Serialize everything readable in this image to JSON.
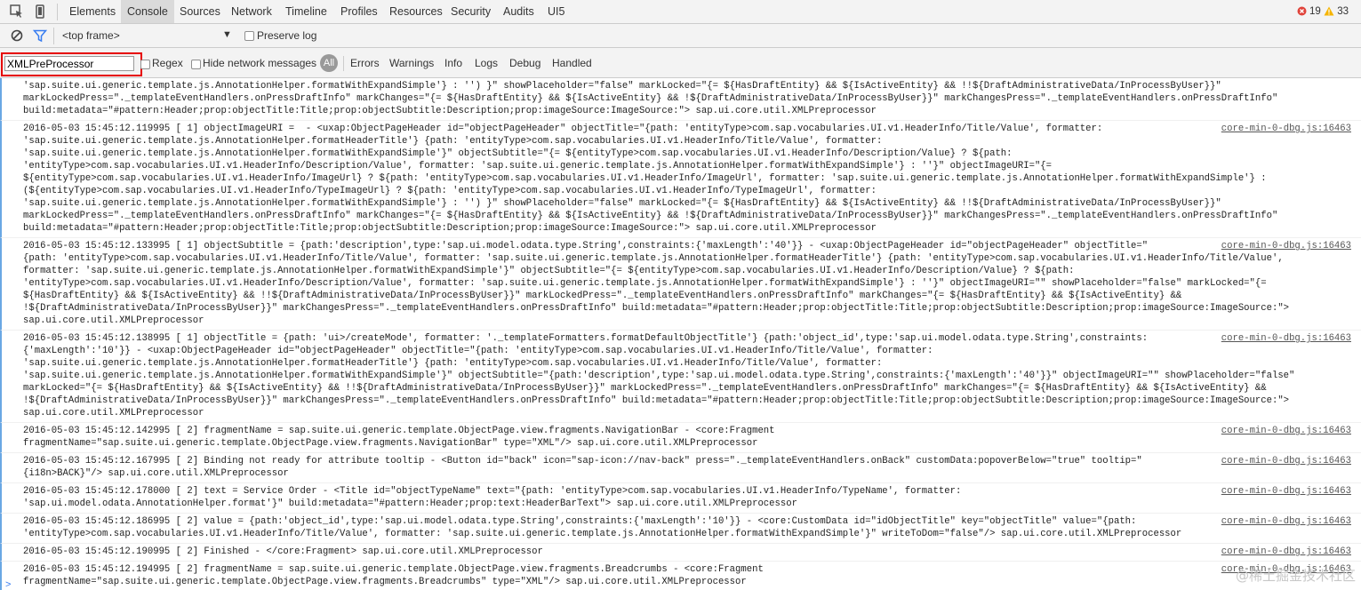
{
  "tabs": [
    {
      "label": "Elements",
      "active": false
    },
    {
      "label": "Console",
      "active": true
    },
    {
      "label": "Sources",
      "active": false
    },
    {
      "label": "Network",
      "active": false
    },
    {
      "label": "Timeline",
      "active": false
    },
    {
      "label": "Profiles",
      "active": false
    },
    {
      "label": "Resources",
      "active": false
    },
    {
      "label": "Security",
      "active": false
    },
    {
      "label": "Audits",
      "active": false
    },
    {
      "label": "UI5",
      "active": false
    }
  ],
  "status": {
    "errors": "19",
    "warnings": "33"
  },
  "toolbar": {
    "frame": "<top frame>",
    "preserve_log": "Preserve log"
  },
  "filter": {
    "value": "XMLPreProcessor",
    "regex": "Regex",
    "hide_network": "Hide network messages",
    "levels": [
      "All",
      "Errors",
      "Warnings",
      "Info",
      "Logs",
      "Debug",
      "Handled"
    ]
  },
  "log": [
    {
      "source": "",
      "lines": [
        "'sap.suite.ui.generic.template.js.AnnotationHelper.formatWithExpandSimple'} : '') }\" showPlaceholder=\"false\" markLocked=\"{= ${HasDraftEntity} && ${IsActiveEntity} && !!${DraftAdministrativeData/InProcessByUser}}\"",
        "markLockedPress=\"._templateEventHandlers.onPressDraftInfo\" markChanges=\"{= ${HasDraftEntity} && ${IsActiveEntity} && !${DraftAdministrativeData/InProcessByUser}}\" markChangesPress=\"._templateEventHandlers.onPressDraftInfo\"",
        "build:metadata=\"#pattern:Header;prop:objectTitle:Title;prop:objectSubtitle:Description;prop:imageSource:ImageSource:\"> sap.ui.core.util.XMLPreprocessor"
      ]
    },
    {
      "source": "core-min-0-dbg.js:16463",
      "lines": [
        "2016-05-03 15:45:12.119995 [ 1] objectImageURI =  - <uxap:ObjectPageHeader id=\"objectPageHeader\" objectTitle=\"{path: 'entityType>com.sap.vocabularies.UI.v1.HeaderInfo/Title/Value', formatter:",
        "'sap.suite.ui.generic.template.js.AnnotationHelper.formatHeaderTitle'} {path: 'entityType>com.sap.vocabularies.UI.v1.HeaderInfo/Title/Value', formatter:",
        "'sap.suite.ui.generic.template.js.AnnotationHelper.formatWithExpandSimple'}\" objectSubtitle=\"{= ${entityType>com.sap.vocabularies.UI.v1.HeaderInfo/Description/Value} ? ${path:",
        "'entityType>com.sap.vocabularies.UI.v1.HeaderInfo/Description/Value', formatter: 'sap.suite.ui.generic.template.js.AnnotationHelper.formatWithExpandSimple'} : ''}\" objectImageURI=\"{=",
        "${entityType>com.sap.vocabularies.UI.v1.HeaderInfo/ImageUrl} ? ${path: 'entityType>com.sap.vocabularies.UI.v1.HeaderInfo/ImageUrl', formatter: 'sap.suite.ui.generic.template.js.AnnotationHelper.formatWithExpandSimple'} :",
        "(${entityType>com.sap.vocabularies.UI.v1.HeaderInfo/TypeImageUrl} ? ${path: 'entityType>com.sap.vocabularies.UI.v1.HeaderInfo/TypeImageUrl', formatter:",
        "'sap.suite.ui.generic.template.js.AnnotationHelper.formatWithExpandSimple'} : '') }\" showPlaceholder=\"false\" markLocked=\"{= ${HasDraftEntity} && ${IsActiveEntity} && !!${DraftAdministrativeData/InProcessByUser}}\"",
        "markLockedPress=\"._templateEventHandlers.onPressDraftInfo\" markChanges=\"{= ${HasDraftEntity} && ${IsActiveEntity} && !${DraftAdministrativeData/InProcessByUser}}\" markChangesPress=\"._templateEventHandlers.onPressDraftInfo\"",
        "build:metadata=\"#pattern:Header;prop:objectTitle:Title;prop:objectSubtitle:Description;prop:imageSource:ImageSource:\"> sap.ui.core.util.XMLPreprocessor"
      ]
    },
    {
      "source": "core-min-0-dbg.js:16463",
      "lines": [
        "2016-05-03 15:45:12.133995 [ 1] objectSubtitle = {path:'description',type:'sap.ui.model.odata.type.String',constraints:{'maxLength':'40'}} - <uxap:ObjectPageHeader id=\"objectPageHeader\" objectTitle=\"",
        "{path: 'entityType>com.sap.vocabularies.UI.v1.HeaderInfo/Title/Value', formatter: 'sap.suite.ui.generic.template.js.AnnotationHelper.formatHeaderTitle'} {path: 'entityType>com.sap.vocabularies.UI.v1.HeaderInfo/Title/Value',",
        "formatter: 'sap.suite.ui.generic.template.js.AnnotationHelper.formatWithExpandSimple'}\" objectSubtitle=\"{= ${entityType>com.sap.vocabularies.UI.v1.HeaderInfo/Description/Value} ? ${path:",
        "'entityType>com.sap.vocabularies.UI.v1.HeaderInfo/Description/Value', formatter: 'sap.suite.ui.generic.template.js.AnnotationHelper.formatWithExpandSimple'} : ''}\" objectImageURI=\"\" showPlaceholder=\"false\" markLocked=\"{=",
        "${HasDraftEntity} && ${IsActiveEntity} && !!${DraftAdministrativeData/InProcessByUser}}\" markLockedPress=\"._templateEventHandlers.onPressDraftInfo\" markChanges=\"{= ${HasDraftEntity} && ${IsActiveEntity} &&",
        "!${DraftAdministrativeData/InProcessByUser}}\" markChangesPress=\"._templateEventHandlers.onPressDraftInfo\" build:metadata=\"#pattern:Header;prop:objectTitle:Title;prop:objectSubtitle:Description;prop:imageSource:ImageSource:\">",
        "sap.ui.core.util.XMLPreprocessor"
      ]
    },
    {
      "source": "core-min-0-dbg.js:16463",
      "lines": [
        "2016-05-03 15:45:12.138995 [ 1] objectTitle = {path: 'ui>/createMode', formatter: '._templateFormatters.formatDefaultObjectTitle'} {path:'object_id',type:'sap.ui.model.odata.type.String',constraints:",
        "{'maxLength':'10'}} - <uxap:ObjectPageHeader id=\"objectPageHeader\" objectTitle=\"{path: 'entityType>com.sap.vocabularies.UI.v1.HeaderInfo/Title/Value', formatter:",
        "'sap.suite.ui.generic.template.js.AnnotationHelper.formatHeaderTitle'} {path: 'entityType>com.sap.vocabularies.UI.v1.HeaderInfo/Title/Value', formatter:",
        "'sap.suite.ui.generic.template.js.AnnotationHelper.formatWithExpandSimple'}\" objectSubtitle=\"{path:'description',type:'sap.ui.model.odata.type.String',constraints:{'maxLength':'40'}}\" objectImageURI=\"\" showPlaceholder=\"false\"",
        "markLocked=\"{= ${HasDraftEntity} && ${IsActiveEntity} && !!${DraftAdministrativeData/InProcessByUser}}\" markLockedPress=\"._templateEventHandlers.onPressDraftInfo\" markChanges=\"{= ${HasDraftEntity} && ${IsActiveEntity} &&",
        "!${DraftAdministrativeData/InProcessByUser}}\" markChangesPress=\"._templateEventHandlers.onPressDraftInfo\" build:metadata=\"#pattern:Header;prop:objectTitle:Title;prop:objectSubtitle:Description;prop:imageSource:ImageSource:\">",
        "sap.ui.core.util.XMLPreprocessor"
      ]
    },
    {
      "source": "core-min-0-dbg.js:16463",
      "lines": [
        "2016-05-03 15:45:12.142995 [ 2] fragmentName = sap.suite.ui.generic.template.ObjectPage.view.fragments.NavigationBar - <core:Fragment",
        "fragmentName=\"sap.suite.ui.generic.template.ObjectPage.view.fragments.NavigationBar\" type=\"XML\"/> sap.ui.core.util.XMLPreprocessor"
      ]
    },
    {
      "source": "core-min-0-dbg.js:16463",
      "lines": [
        "2016-05-03 15:45:12.167995 [ 2] Binding not ready for attribute tooltip - <Button id=\"back\" icon=\"sap-icon://nav-back\" press=\"._templateEventHandlers.onBack\" customData:popoverBelow=\"true\" tooltip=\"",
        "{i18n>BACK}\"/> sap.ui.core.util.XMLPreprocessor"
      ]
    },
    {
      "source": "core-min-0-dbg.js:16463",
      "lines": [
        "2016-05-03 15:45:12.178000 [ 2] text = Service Order - <Title id=\"objectTypeName\" text=\"{path: 'entityType>com.sap.vocabularies.UI.v1.HeaderInfo/TypeName', formatter:",
        "'sap.ui.model.odata.AnnotationHelper.format'}\" build:metadata=\"#pattern:Header;prop:text:HeaderBarText\"> sap.ui.core.util.XMLPreprocessor"
      ]
    },
    {
      "source": "core-min-0-dbg.js:16463",
      "lines": [
        "2016-05-03 15:45:12.186995 [ 2] value = {path:'object_id',type:'sap.ui.model.odata.type.String',constraints:{'maxLength':'10'}} - <core:CustomData id=\"idObjectTitle\" key=\"objectTitle\" value=\"{path:",
        "'entityType>com.sap.vocabularies.UI.v1.HeaderInfo/Title/Value', formatter: 'sap.suite.ui.generic.template.js.AnnotationHelper.formatWithExpandSimple'}\" writeToDom=\"false\"/> sap.ui.core.util.XMLPreprocessor"
      ]
    },
    {
      "source": "core-min-0-dbg.js:16463",
      "lines": [
        "2016-05-03 15:45:12.190995 [ 2] Finished - </core:Fragment> sap.ui.core.util.XMLPreprocessor"
      ]
    },
    {
      "source": "core-min-0-dbg.js:16463",
      "lines": [
        "2016-05-03 15:45:12.194995 [ 2] fragmentName = sap.suite.ui.generic.template.ObjectPage.view.fragments.Breadcrumbs - <core:Fragment",
        "fragmentName=\"sap.suite.ui.generic.template.ObjectPage.view.fragments.Breadcrumbs\" type=\"XML\"/> sap.ui.core.util.XMLPreprocessor"
      ]
    }
  ],
  "prompt_symbol": ">",
  "watermark": "@稀土掘金技术社区",
  "colors": {
    "accent": "#367cf1",
    "highlight": "#e60000",
    "error": "#e0433a",
    "warning": "#f5b400"
  },
  "icons": [
    "inspect-icon",
    "device-icon",
    "clear-icon",
    "filter-icon",
    "error-icon",
    "warning-icon"
  ]
}
